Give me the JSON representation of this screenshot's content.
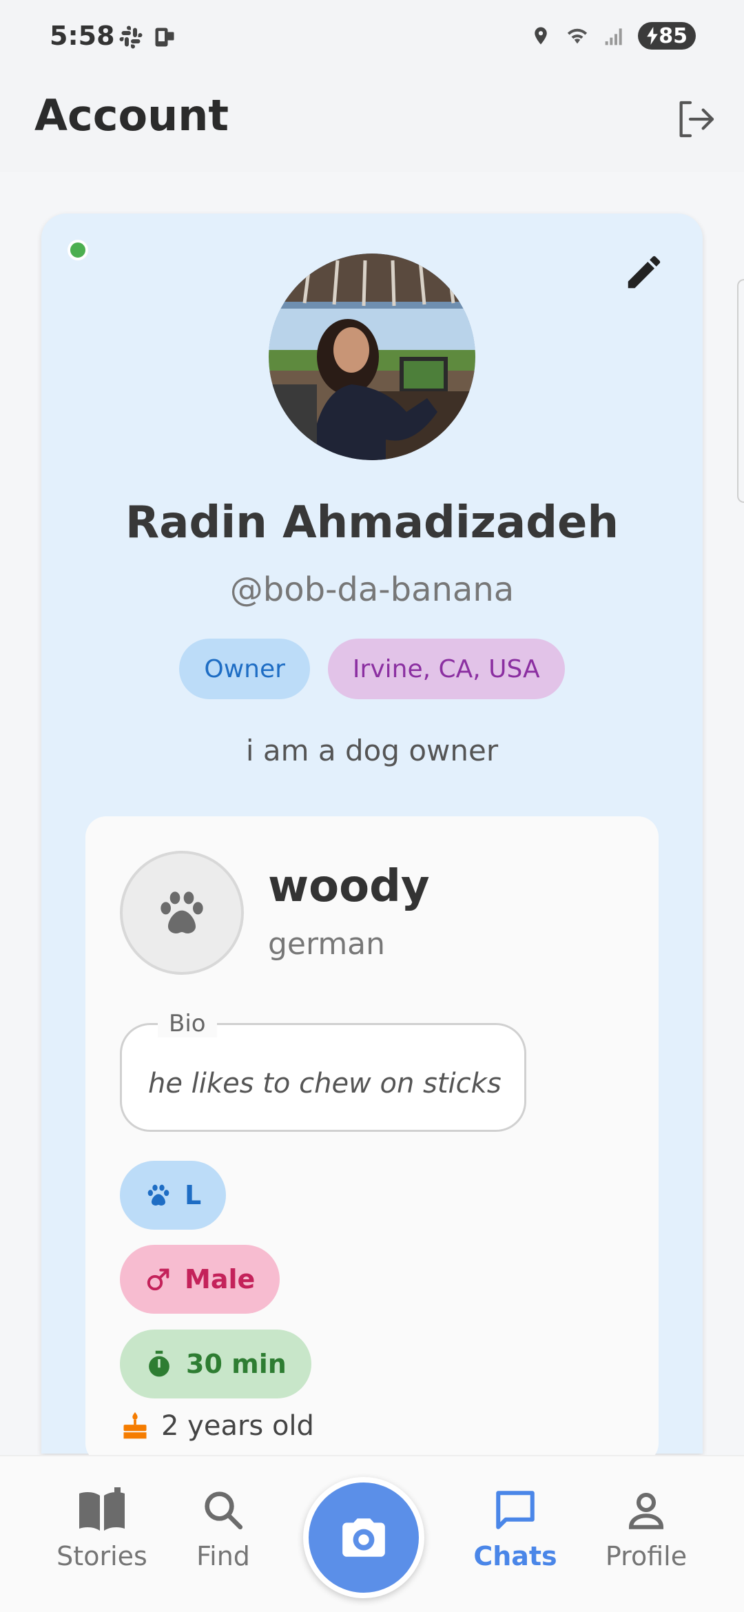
{
  "status_bar": {
    "time": "5:58",
    "battery": "85",
    "icons": [
      "slack-icon",
      "device-icon",
      "location-icon",
      "wifi-icon",
      "signal-icon",
      "battery-icon"
    ]
  },
  "app_bar": {
    "title": "Account",
    "logout_icon": "logout-icon"
  },
  "profile": {
    "name": "Radin Ahmadizadeh",
    "handle": "@bob-da-banana",
    "role_chip": "Owner",
    "location_chip": "Irvine, CA, USA",
    "tagline": "i am a dog owner",
    "online": true
  },
  "pet": {
    "name": "woody",
    "breed": "german",
    "bio_label": "Bio",
    "bio": "he likes to chew on sticks",
    "size": "L",
    "gender": "Male",
    "walk": "30 min",
    "age": "2 years old"
  },
  "bottom_nav": {
    "items": [
      {
        "label": "Stories",
        "icon": "book-icon",
        "active": false
      },
      {
        "label": "Find",
        "icon": "search-icon",
        "active": false
      },
      {
        "label": "Chats",
        "icon": "chat-icon",
        "active": true
      },
      {
        "label": "Profile",
        "icon": "person-icon",
        "active": false
      }
    ],
    "fab_icon": "camera-icon"
  },
  "colors": {
    "accent": "#4a86e8",
    "card_bg": "#e3f0fc",
    "online": "#4caf50"
  }
}
